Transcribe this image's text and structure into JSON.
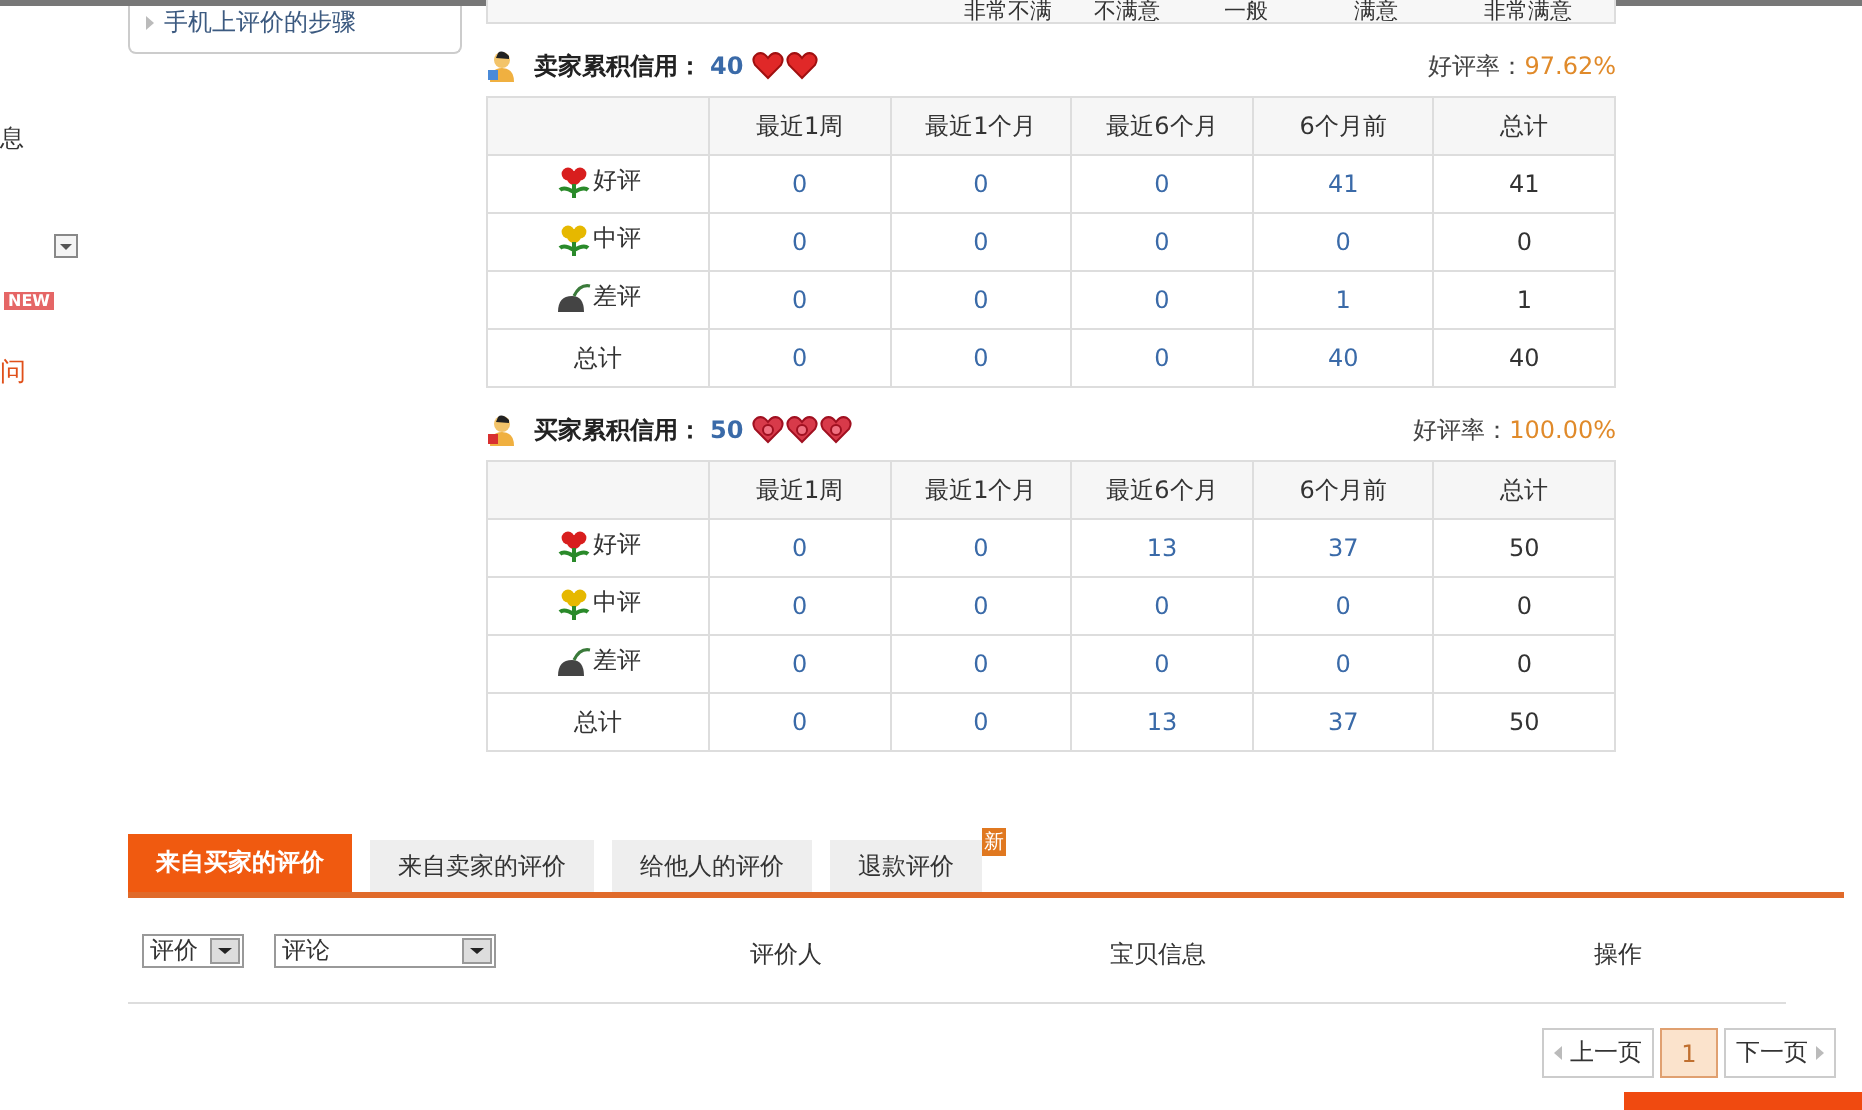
{
  "help_box": {
    "link": "手机上评价的步骤"
  },
  "sidebar": {
    "items": [
      {
        "kind": "text",
        "label": "息"
      },
      {
        "kind": "dropdown"
      },
      {
        "kind": "badge",
        "label": "NEW"
      },
      {
        "kind": "link",
        "label": "问"
      }
    ]
  },
  "rating_scale": [
    "非常不满",
    "不满意",
    "一般",
    "满意",
    "非常满意"
  ],
  "credit_sections": [
    {
      "title": "卖家累积信用：",
      "score": "40",
      "hearts": [
        {
          "kind": "heart"
        },
        {
          "kind": "heart"
        }
      ],
      "rate_label": "好评率：",
      "rate": "97.62%",
      "columns": [
        "最近1周",
        "最近1个月",
        "最近6个月",
        "6个月前",
        "总计"
      ],
      "rows": [
        {
          "kind": "good",
          "label": "好评",
          "values": [
            "0",
            "0",
            "0",
            "41",
            "41"
          ]
        },
        {
          "kind": "neutral",
          "label": "中评",
          "values": [
            "0",
            "0",
            "0",
            "0",
            "0"
          ]
        },
        {
          "kind": "bad",
          "label": "差评",
          "values": [
            "0",
            "0",
            "0",
            "1",
            "1"
          ]
        },
        {
          "kind": "total",
          "label": "总计",
          "values": [
            "0",
            "0",
            "0",
            "40",
            "40"
          ]
        }
      ]
    },
    {
      "title": "买家累积信用：",
      "score": "50",
      "hearts": [
        {
          "kind": "ring-heart"
        },
        {
          "kind": "ring-heart"
        },
        {
          "kind": "ring-heart"
        }
      ],
      "rate_label": "好评率：",
      "rate": "100.00%",
      "columns": [
        "最近1周",
        "最近1个月",
        "最近6个月",
        "6个月前",
        "总计"
      ],
      "rows": [
        {
          "kind": "good",
          "label": "好评",
          "values": [
            "0",
            "0",
            "13",
            "37",
            "50"
          ]
        },
        {
          "kind": "neutral",
          "label": "中评",
          "values": [
            "0",
            "0",
            "0",
            "0",
            "0"
          ]
        },
        {
          "kind": "bad",
          "label": "差评",
          "values": [
            "0",
            "0",
            "0",
            "0",
            "0"
          ]
        },
        {
          "kind": "total",
          "label": "总计",
          "values": [
            "0",
            "0",
            "13",
            "37",
            "50"
          ]
        }
      ]
    }
  ],
  "tabs": [
    {
      "label": "来自买家的评价",
      "selected": true
    },
    {
      "label": "来自卖家的评价",
      "selected": false
    },
    {
      "label": "给他人的评价",
      "selected": false
    },
    {
      "label": "退款评价",
      "selected": false,
      "new_badge": "新"
    }
  ],
  "filters": [
    {
      "value": "评价"
    },
    {
      "value": "评论"
    }
  ],
  "list_columns": [
    "评价人",
    "宝贝信息",
    "操作"
  ],
  "pagination": {
    "prev": "上一页",
    "pages": [
      {
        "label": "1",
        "selected": true
      }
    ],
    "next": "下一页"
  }
}
